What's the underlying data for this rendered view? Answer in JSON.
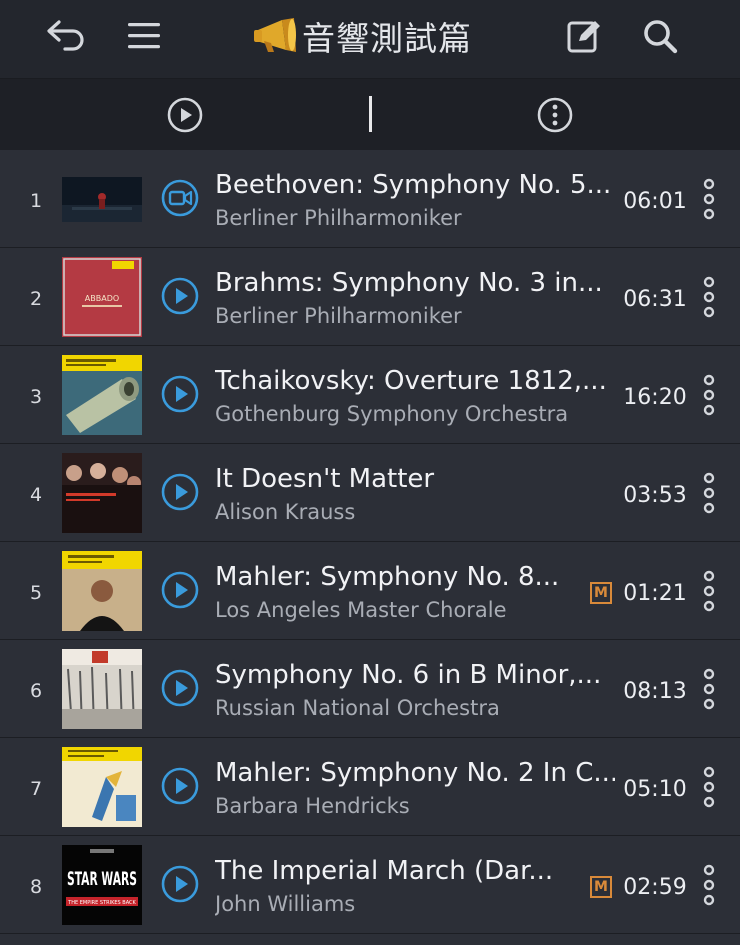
{
  "header": {
    "title": "音響測試篇",
    "icons": [
      "back-arrow-icon",
      "menu-icon",
      "megaphone-icon",
      "edit-icon",
      "search-icon"
    ]
  },
  "toolbar": {
    "icons": [
      "play-circle-icon",
      "more-vertical-circle-icon"
    ]
  },
  "colors": {
    "accent": "#3a9bdc",
    "badge": "#d98a3a",
    "background": "#2c2f37",
    "header": "#23262d"
  },
  "tracks": [
    {
      "num": "1",
      "title": "Beethoven: Symphony No. 5...",
      "artist": "Berliner Philharmoniker",
      "duration": "06:01",
      "icon": "video-icon",
      "badge": ""
    },
    {
      "num": "2",
      "title": "Brahms: Symphony No. 3 in...",
      "artist": "Berliner Philharmoniker",
      "duration": "06:31",
      "icon": "play-icon",
      "badge": "",
      "cover_text": "ABBADO"
    },
    {
      "num": "3",
      "title": "Tchaikovsky: Overture 1812,...",
      "artist": "Gothenburg Symphony Orchestra",
      "duration": "16:20",
      "icon": "play-icon",
      "badge": ""
    },
    {
      "num": "4",
      "title": "It Doesn't Matter",
      "artist": "Alison Krauss",
      "duration": "03:53",
      "icon": "play-icon",
      "badge": ""
    },
    {
      "num": "5",
      "title": "Mahler: Symphony No. 8...",
      "artist": "Los Angeles Master Chorale",
      "duration": "01:21",
      "icon": "play-icon",
      "badge": "M"
    },
    {
      "num": "6",
      "title": "Symphony No. 6 in B Minor,...",
      "artist": "Russian National Orchestra",
      "duration": "08:13",
      "icon": "play-icon",
      "badge": ""
    },
    {
      "num": "7",
      "title": "Mahler: Symphony No. 2 In C...",
      "artist": "Barbara Hendricks",
      "duration": "05:10",
      "icon": "play-icon",
      "badge": ""
    },
    {
      "num": "8",
      "title": "The Imperial March (Dar...",
      "artist": "John Williams",
      "duration": "02:59",
      "icon": "play-icon",
      "badge": "M",
      "cover_text": "STAR WARS",
      "cover_subtext": "THE EMPIRE STRIKES BACK"
    }
  ]
}
